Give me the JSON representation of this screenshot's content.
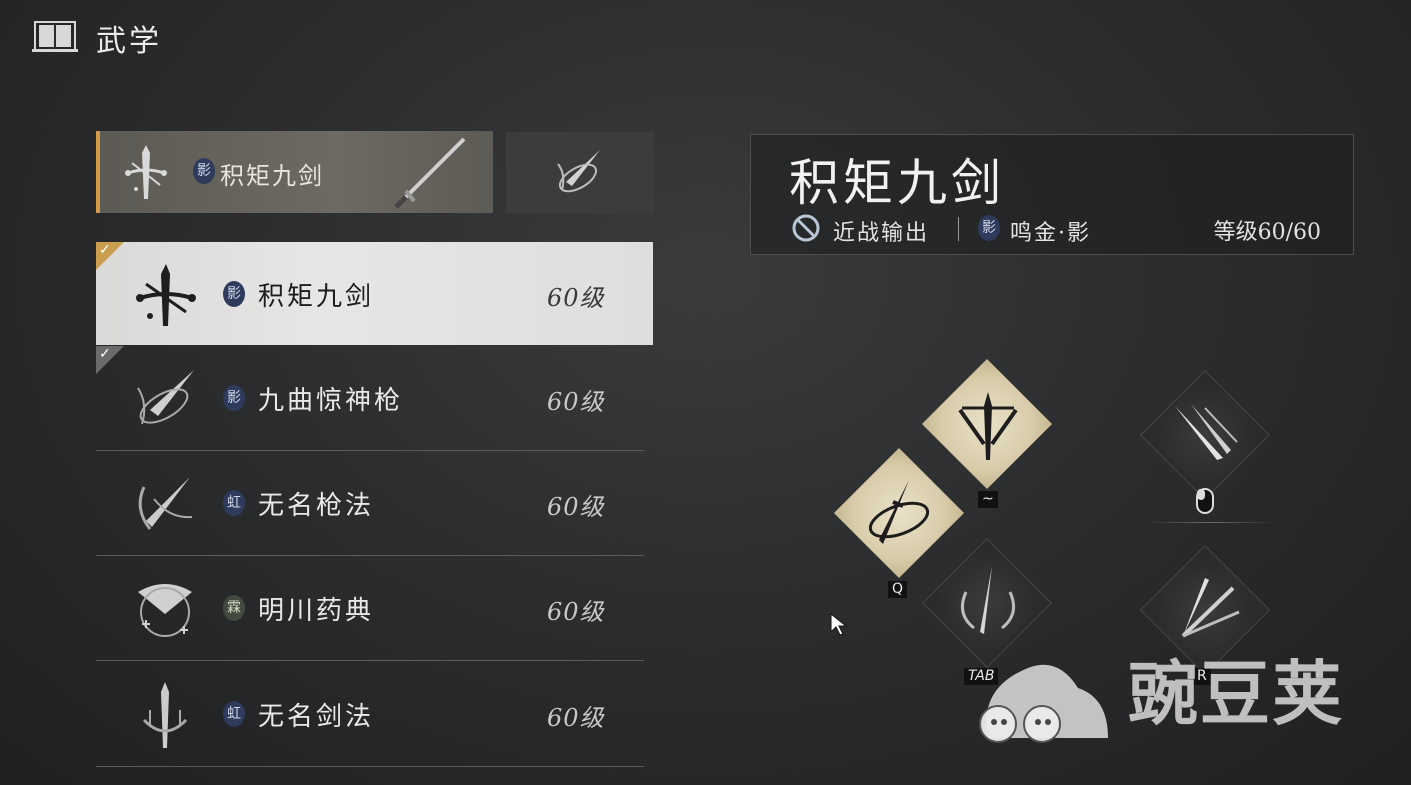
{
  "header": {
    "title": "武学",
    "icon": "book-icon"
  },
  "equipped": {
    "name": "积矩九剑",
    "badge": "影",
    "icon": "sword-skill-icon",
    "weapon_icon": "sword-weapon-icon"
  },
  "secondary_slot": {
    "icon": "spear-skill-icon"
  },
  "skills": [
    {
      "name": "积矩九剑",
      "badge": "影",
      "level": "60级",
      "selected": true,
      "equipped": true,
      "icon": "sword-skill-icon"
    },
    {
      "name": "九曲惊神枪",
      "badge": "影",
      "level": "60级",
      "selected": false,
      "equipped": true,
      "icon": "spear-skill-icon"
    },
    {
      "name": "无名枪法",
      "badge": "虹",
      "level": "60级",
      "selected": false,
      "equipped": false,
      "icon": "spear-skill-icon"
    },
    {
      "name": "明川药典",
      "badge": "霖",
      "level": "60级",
      "selected": false,
      "equipped": false,
      "icon": "fan-skill-icon"
    },
    {
      "name": "无名剑法",
      "badge": "虹",
      "level": "60级",
      "selected": false,
      "equipped": false,
      "icon": "sword-skill-icon"
    }
  ],
  "detail": {
    "title": "积矩九剑",
    "role": "近战输出",
    "school_badge": "影",
    "school": "鸣金·影",
    "grade": "等级60/60"
  },
  "abilities": {
    "key_tilde": "~",
    "key_q": "Q",
    "key_tab": "TAB",
    "key_r": "R"
  },
  "watermark": {
    "text": "豌豆荚"
  },
  "colors": {
    "accent": "#d39a45",
    "badge_blue": "#2e3b5c",
    "selected_bg": "#e2e2e1",
    "gold_diamond": "#d8ccaa"
  }
}
